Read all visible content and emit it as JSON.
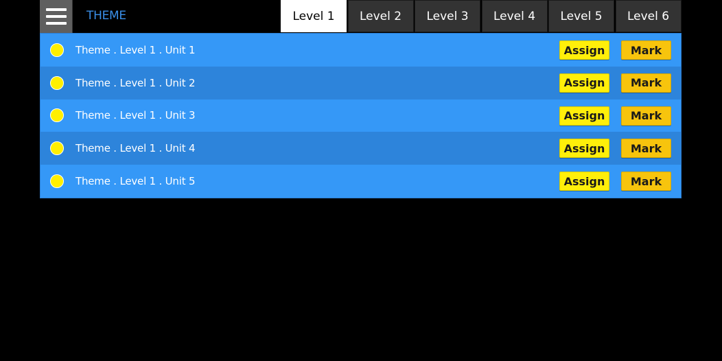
{
  "header": {
    "menu_icon": "hamburger-menu-icon",
    "title": "THEME",
    "tabs": [
      {
        "label": "Level 1",
        "active": true
      },
      {
        "label": "Level 2",
        "active": false
      },
      {
        "label": "Level 3",
        "active": false
      },
      {
        "label": "Level 4",
        "active": false
      },
      {
        "label": "Level 5",
        "active": false
      },
      {
        "label": "Level 6",
        "active": false
      }
    ]
  },
  "units": [
    {
      "label": "Theme . Level 1 . Unit 1",
      "assign": "Assign",
      "mark": "Mark"
    },
    {
      "label": "Theme . Level 1 . Unit 2",
      "assign": "Assign",
      "mark": "Mark"
    },
    {
      "label": "Theme . Level 1 . Unit 3",
      "assign": "Assign",
      "mark": "Mark"
    },
    {
      "label": "Theme . Level 1 . Unit 4",
      "assign": "Assign",
      "mark": "Mark"
    },
    {
      "label": "Theme . Level 1 . Unit 5",
      "assign": "Assign",
      "mark": "Mark"
    }
  ],
  "colors": {
    "accent": "#3a8fe8",
    "row_light": "#3598f7",
    "row_dark": "#2d84db",
    "assign_button": "#ffef0a",
    "mark_button": "#f7c40d",
    "status_dot": "#ffef00"
  }
}
